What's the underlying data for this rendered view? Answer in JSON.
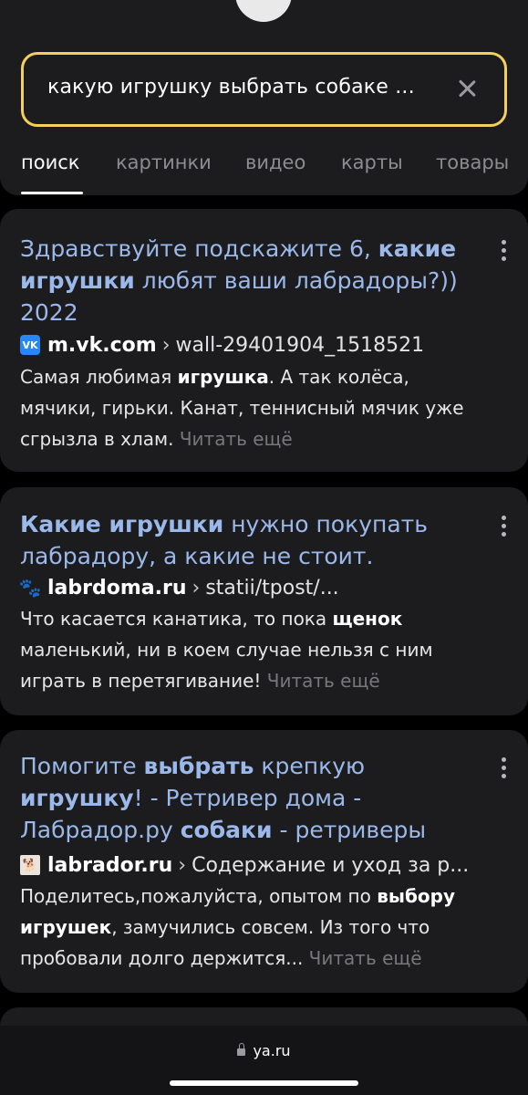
{
  "search": {
    "query": "какую игрушку выбрать собаке ...",
    "clear_icon": "close-icon"
  },
  "tabs": [
    {
      "label": "поиск",
      "active": true
    },
    {
      "label": "картинки",
      "active": false
    },
    {
      "label": "видео",
      "active": false
    },
    {
      "label": "карты",
      "active": false
    },
    {
      "label": "товары",
      "active": false
    }
  ],
  "results": [
    {
      "title_lines": [
        [
          {
            "t": "Здравствуйте подскажите 6, ",
            "b": false
          },
          {
            "t": "какие",
            "b": true
          }
        ],
        [
          {
            "t": "игрушки",
            "b": true
          },
          {
            "t": " любят ваши лабрадоры?))",
            "b": false
          }
        ],
        [
          {
            "t": "2022",
            "b": false
          }
        ]
      ],
      "favicon": "vk-icon",
      "favicon_text": "VK",
      "domain": "m.vk.com",
      "separator": "›",
      "path": "wall-29401904_1518521",
      "snippet_lines": [
        [
          {
            "t": "Самая любимая ",
            "b": false
          },
          {
            "t": "игрушка",
            "b": true
          },
          {
            "t": ". А так колёса,",
            "b": false
          }
        ],
        [
          {
            "t": "мячики, гирьки. Канат, теннисный мячик уже",
            "b": false
          }
        ],
        [
          {
            "t": "сгрызла в хлам. ",
            "b": false
          }
        ]
      ],
      "read_more": "Читать ещё"
    },
    {
      "title_lines": [
        [
          {
            "t": "Какие игрушки",
            "b": true
          },
          {
            "t": " нужно покупать",
            "b": false
          }
        ],
        [
          {
            "t": "лабрадору, а какие не стоит.",
            "b": false
          }
        ]
      ],
      "favicon": "paw-icon",
      "favicon_text": "🐾",
      "domain": "labrdoma.ru",
      "separator": "›",
      "path": "statii/tpost/...",
      "snippet_lines": [
        [
          {
            "t": "Что касается канатика, то пока ",
            "b": false
          },
          {
            "t": "щенок",
            "b": true
          }
        ],
        [
          {
            "t": "маленький, ни в коем случае нельзя с ним",
            "b": false
          }
        ],
        [
          {
            "t": "играть в перетягивание! ",
            "b": false
          }
        ]
      ],
      "read_more": "Читать ещё"
    },
    {
      "title_lines": [
        [
          {
            "t": "Помогите ",
            "b": false
          },
          {
            "t": "выбрать",
            "b": true
          },
          {
            "t": " крепкую",
            "b": false
          }
        ],
        [
          {
            "t": "игрушку",
            "b": true
          },
          {
            "t": "! - Ретривер дома -",
            "b": false
          }
        ],
        [
          {
            "t": "Лабрадор.ру ",
            "b": false
          },
          {
            "t": "собаки",
            "b": true
          },
          {
            "t": " - ретриверы",
            "b": false
          }
        ]
      ],
      "favicon": "labrador-site-icon",
      "favicon_text": "🐕",
      "domain": "labrador.ru",
      "separator": "›",
      "path": "Содержание и уход за р...",
      "snippet_lines": [
        [
          {
            "t": "Поделитесь,пожалуйста, опытом по ",
            "b": false
          },
          {
            "t": "выбору",
            "b": true
          }
        ],
        [
          {
            "t": "игрушек",
            "b": true
          },
          {
            "t": ", замучились совсем. Из того что",
            "b": false
          }
        ],
        [
          {
            "t": "пробовали долго держится... ",
            "b": false
          }
        ]
      ],
      "read_more": "Читать ещё"
    }
  ],
  "browser": {
    "address": "ya.ru",
    "lock_icon": "lock-icon"
  }
}
